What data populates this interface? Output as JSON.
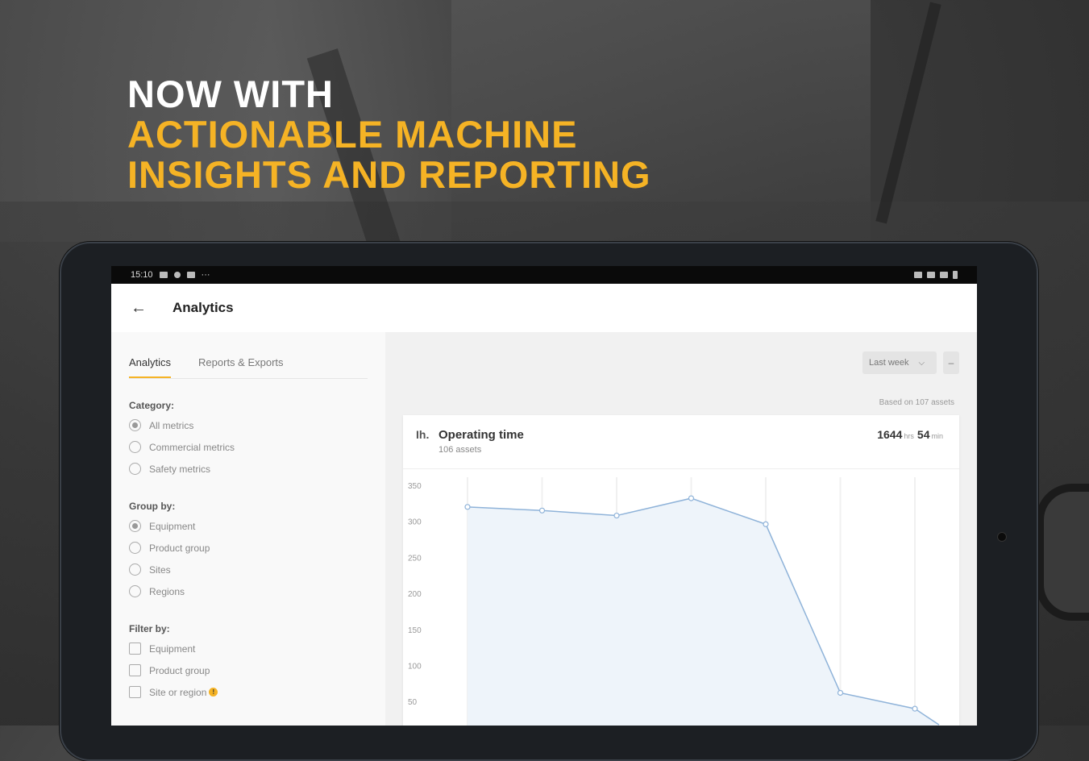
{
  "headline": {
    "line1": "NOW WITH",
    "line2": "ACTIONABLE MACHINE",
    "line3": "INSIGHTS AND REPORTING"
  },
  "statusbar": {
    "time": "15:10"
  },
  "appbar": {
    "title": "Analytics"
  },
  "tabs": [
    {
      "label": "Analytics",
      "active": true
    },
    {
      "label": "Reports & Exports",
      "active": false
    }
  ],
  "category": {
    "title": "Category:",
    "options": [
      "All metrics",
      "Commercial metrics",
      "Safety metrics"
    ],
    "selected": 0
  },
  "group_by": {
    "title": "Group by:",
    "options": [
      "Equipment",
      "Product group",
      "Sites",
      "Regions"
    ],
    "selected": 0
  },
  "filter_by": {
    "title": "Filter by:",
    "options": [
      "Equipment",
      "Product group",
      "Site or region"
    ]
  },
  "toolbar": {
    "period": "Last week",
    "more": "–"
  },
  "based_on": "Based on 107 assets",
  "card": {
    "title": "Operating time",
    "subtitle": "106 assets",
    "total_hours": "1644",
    "hours_unit": "hrs",
    "total_minutes": "54",
    "minutes_unit": "min"
  },
  "colors": {
    "accent": "#f5b325",
    "line": "#8fb3d9",
    "area": "#eef4fa"
  },
  "chart_data": {
    "type": "area",
    "title": "Operating time",
    "xlabel": "",
    "ylabel": "",
    "ylim": [
      0,
      350
    ],
    "yticks": [
      350,
      300,
      250,
      200,
      150,
      100,
      50
    ],
    "x": [
      1,
      2,
      3,
      4,
      5,
      6,
      7
    ],
    "series": [
      {
        "values": [
          320,
          315,
          308,
          332,
          296,
          62,
          40
        ]
      }
    ],
    "grid": true
  }
}
